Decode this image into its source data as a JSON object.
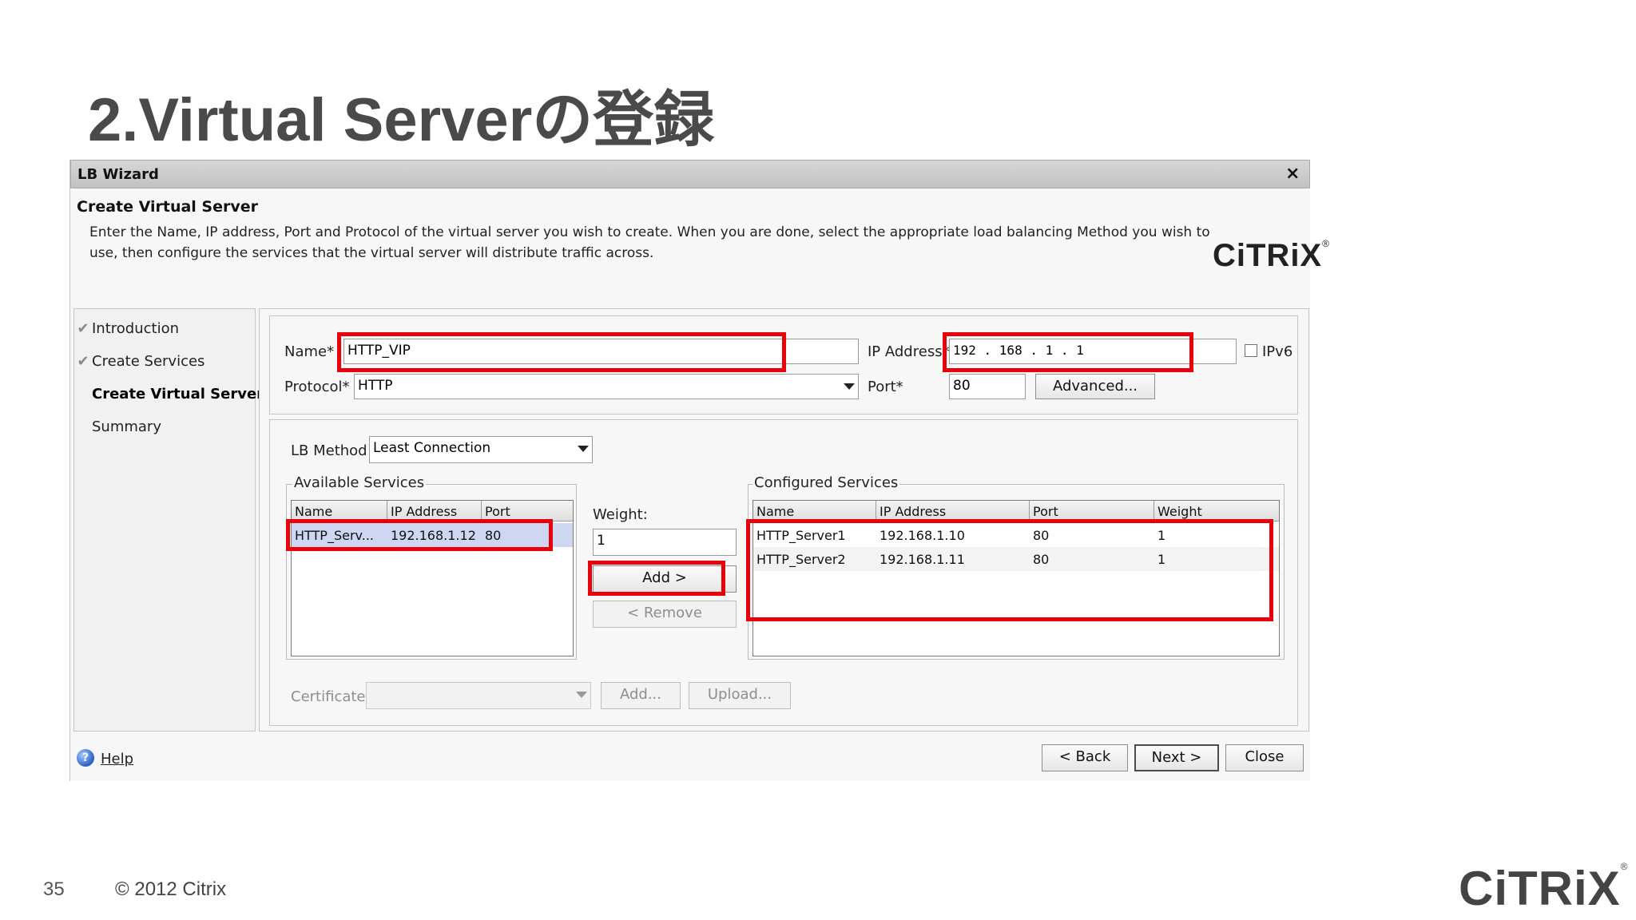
{
  "slide": {
    "title": "2.Virtual Serverの登録",
    "page_number": "35",
    "copyright": "© 2012 Citrix",
    "logo": "CiTRiX",
    "logo_mark": "®"
  },
  "window": {
    "title": "LB Wizard",
    "close_label": "×",
    "headline": "Create Virtual Server",
    "description": "Enter the Name, IP address, Port and Protocol of the virtual server you wish to create. When you are done, select the appropriate load balancing Method you wish to use, then configure the services that the virtual server will distribute traffic across.",
    "logo": "CiTRiX",
    "logo_mark": "®"
  },
  "nav": {
    "items": [
      {
        "label": "Introduction",
        "check": "✔"
      },
      {
        "label": "Create Services",
        "check": "✔"
      },
      {
        "label": "Create Virtual Server",
        "check": ""
      },
      {
        "label": "Summary",
        "check": ""
      }
    ]
  },
  "form": {
    "name_label": "Name*",
    "name_value": "HTTP_VIP",
    "ip_label": "IP Address*",
    "ip_value": "192 . 168 . 1    . 1",
    "ipv6_label": "IPv6",
    "protocol_label": "Protocol*",
    "protocol_value": "HTTP",
    "port_label": "Port*",
    "port_value": "80",
    "advanced_label": "Advanced..."
  },
  "lb": {
    "method_label": "LB Method",
    "method_value": "Least Connection"
  },
  "available": {
    "legend": "Available Services",
    "headers": [
      "Name",
      "IP Address",
      "Port"
    ],
    "rows": [
      {
        "name": "HTTP_Serv...",
        "ip": "192.168.1.12",
        "port": "80"
      }
    ]
  },
  "weight": {
    "label": "Weight:",
    "value": "1",
    "add_label": "Add >",
    "remove_label": "< Remove"
  },
  "configured": {
    "legend": "Configured Services",
    "headers": [
      "Name",
      "IP Address",
      "Port",
      "Weight"
    ],
    "rows": [
      {
        "name": "HTTP_Server1",
        "ip": "192.168.1.10",
        "port": "80",
        "weight": "1"
      },
      {
        "name": "HTTP_Server2",
        "ip": "192.168.1.11",
        "port": "80",
        "weight": "1"
      }
    ]
  },
  "certificate": {
    "label": "Certificate",
    "add_label": "Add...",
    "upload_label": "Upload..."
  },
  "bottom": {
    "help_icon_glyph": "?",
    "help_label": "Help",
    "back_label": "< Back",
    "next_label": "Next >",
    "close_label": "Close"
  },
  "colors": {
    "highlight": "#e8000b",
    "selection": "#cfd6f2",
    "title_text": "#4a4a4a"
  },
  "icons": [
    "close-icon",
    "check-icon",
    "dropdown-arrow-icon",
    "help-icon"
  ]
}
